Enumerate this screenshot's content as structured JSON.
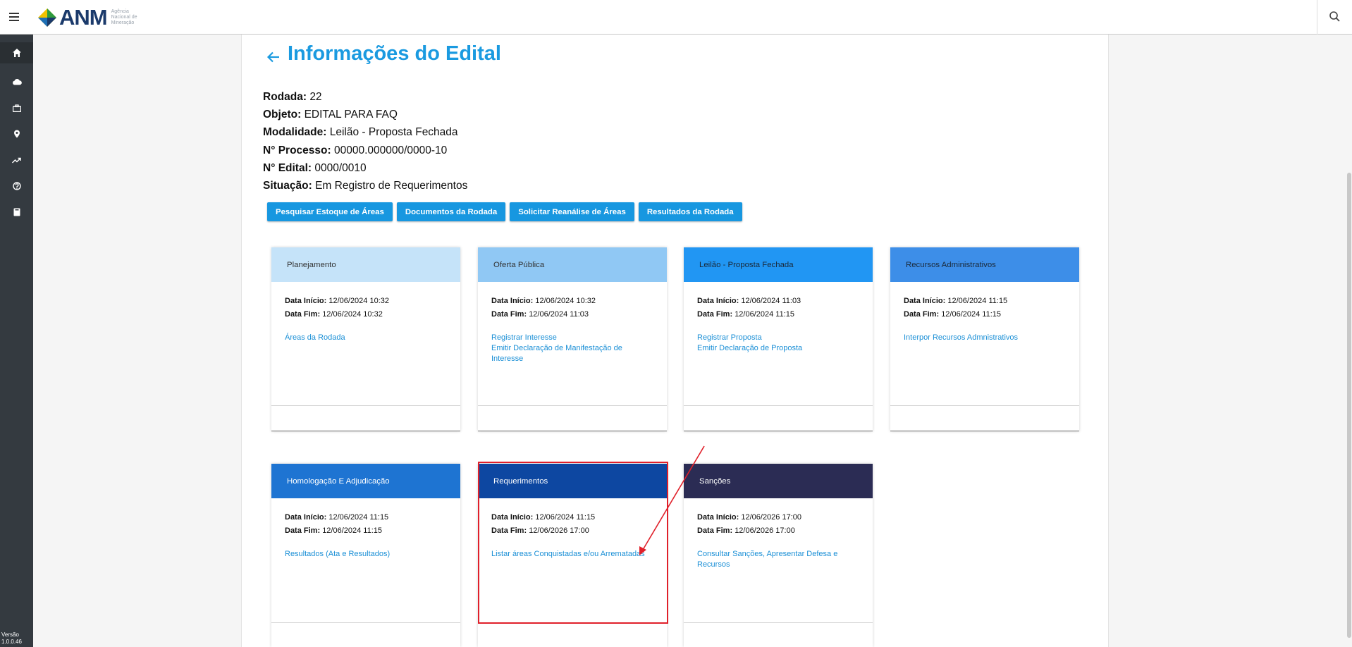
{
  "header": {
    "logo_text": "ANM",
    "logo_sub": "Agência Nacional de Mineração",
    "menu_icon": "hamburger-menu-icon",
    "search_icon": "search-icon"
  },
  "sidebar": {
    "items": [
      {
        "icon": "home-icon"
      },
      {
        "icon": "cloud-icon"
      },
      {
        "icon": "briefcase-icon"
      },
      {
        "icon": "map-pin-icon"
      },
      {
        "icon": "trending-up-icon"
      },
      {
        "icon": "help-circle-icon"
      },
      {
        "icon": "book-icon"
      }
    ],
    "version_label": "Versão",
    "version_value": "1.0.0.46"
  },
  "page": {
    "title": "Informações do Edital",
    "info": [
      {
        "label": "Rodada:",
        "value": "22"
      },
      {
        "label": "Objeto:",
        "value": "EDITAL PARA FAQ"
      },
      {
        "label": "Modalidade:",
        "value": "Leilão - Proposta Fechada"
      },
      {
        "label": "N° Processo:",
        "value": "00000.000000/0000-10"
      },
      {
        "label": "N° Edital:",
        "value": "0000/0010"
      },
      {
        "label": "Situação:",
        "value": "Em Registro de Requerimentos"
      }
    ],
    "buttons": [
      "Pesquisar Estoque de Áreas",
      "Documentos da Rodada",
      "Solicitar Reanálise de Áreas",
      "Resultados da Rodada"
    ]
  },
  "labels": {
    "start": "Data Início:",
    "end": "Data Fim:"
  },
  "colors": {
    "accent": "#1a9ae0",
    "highlight": "#e0202a"
  },
  "cards": [
    {
      "title": "Planejamento",
      "head_bg": "#c5e3f9",
      "head_fg": "#333333",
      "start": "12/06/2024 10:32",
      "end": "12/06/2024 10:32",
      "links": [
        "Áreas da Rodada"
      ]
    },
    {
      "title": "Oferta Pública",
      "head_bg": "#90c8f4",
      "head_fg": "#333333",
      "start": "12/06/2024 10:32",
      "end": "12/06/2024 11:03",
      "links": [
        "Registrar Interesse",
        "Emitir Declaração de Manifestação de Interesse"
      ]
    },
    {
      "title": "Leilão - Proposta Fechada",
      "head_bg": "#2196f3",
      "head_fg": "#1b2a3a",
      "start": "12/06/2024 11:03",
      "end": "12/06/2024 11:15",
      "links": [
        "Registrar Proposta",
        "Emitir Declaração de Proposta"
      ]
    },
    {
      "title": "Recursos Administrativos",
      "head_bg": "#3d8ee8",
      "head_fg": "#1b2a3a",
      "start": "12/06/2024 11:15",
      "end": "12/06/2024 11:15",
      "links": [
        "Interpor Recursos Admnistrativos"
      ]
    },
    {
      "title": "Homologação E Adjudicação",
      "head_bg": "#1e74d2",
      "head_fg": "#ffffff",
      "start": "12/06/2024 11:15",
      "end": "12/06/2024 11:15",
      "links": [
        "Resultados (Ata e Resultados)"
      ]
    },
    {
      "title": "Requerimentos",
      "head_bg": "#0d47a1",
      "head_fg": "#ffffff",
      "start": "12/06/2024 11:15",
      "end": "12/06/2026 17:00",
      "links": [
        "Listar áreas Conquistadas e/ou Arrematadas"
      ]
    },
    {
      "title": "Sanções",
      "head_bg": "#2b2c54",
      "head_fg": "#ffffff",
      "start": "12/06/2026 17:00",
      "end": "12/06/2026 17:00",
      "links": [
        "Consultar Sanções, Apresentar Defesa e Recursos"
      ]
    }
  ]
}
